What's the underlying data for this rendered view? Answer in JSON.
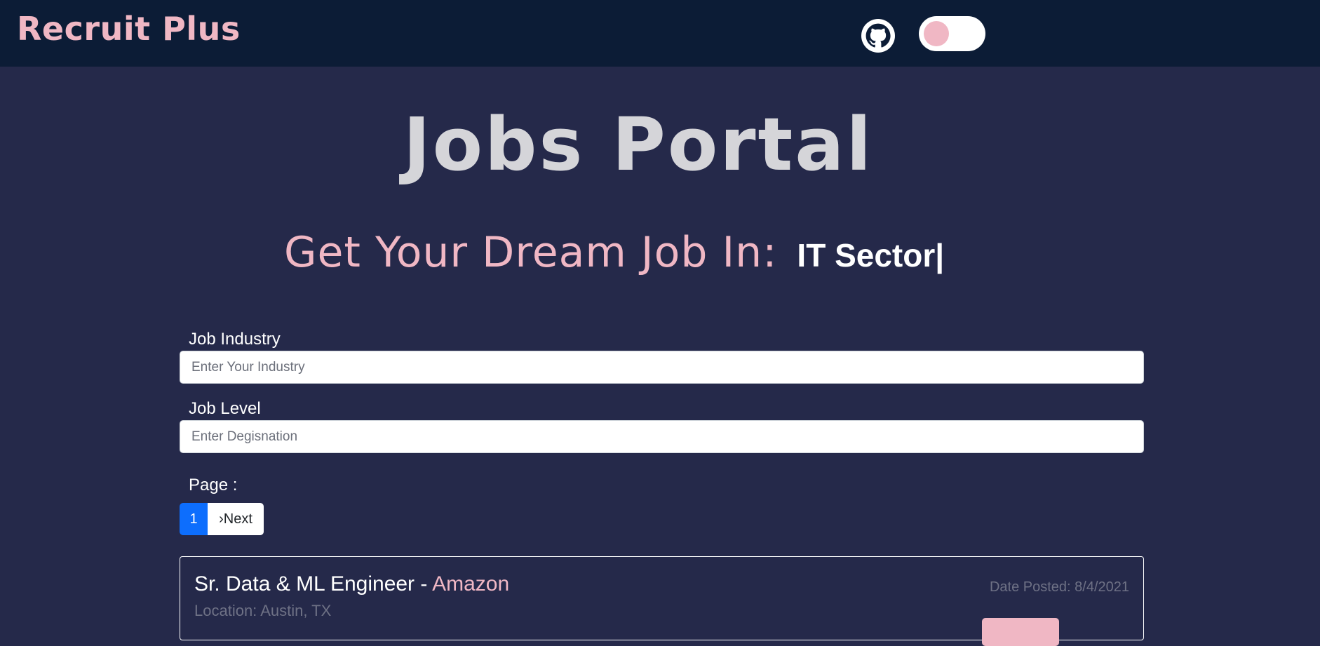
{
  "navbar": {
    "brand": "Recruit Plus",
    "github_icon": "github-icon",
    "theme_toggle": "theme-toggle"
  },
  "hero": {
    "title": "Jobs Portal",
    "tagline_lead": "Get Your Dream Job In:",
    "tagline_typed": "IT Sector|"
  },
  "filters": {
    "industry_label": "Job Industry",
    "industry_placeholder": "Enter Your Industry",
    "level_label": "Job Level",
    "level_placeholder": "Enter Degisnation"
  },
  "pagination": {
    "label": "Page :",
    "current": "1",
    "next": "›Next"
  },
  "jobs": [
    {
      "title": "Sr. Data & ML Engineer",
      "separator": " - ",
      "company": "Amazon",
      "location": "Location: Austin, TX",
      "date_posted": "Date Posted: 8/4/2021"
    }
  ],
  "colors": {
    "navbar_bg": "#0c1c36",
    "page_bg": "#25294a",
    "accent_pink": "#f0b7c4",
    "pager_active": "#0d6efd"
  }
}
